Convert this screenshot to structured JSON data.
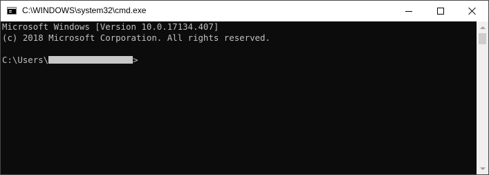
{
  "window": {
    "title": "C:\\WINDOWS\\system32\\cmd.exe",
    "icon": "cmd-icon",
    "controls": [
      "minimize-icon",
      "maximize-icon",
      "close-icon"
    ]
  },
  "console": {
    "line1": "Microsoft Windows [Version 10.0.17134.407]",
    "line2": "(c) 2018 Microsoft Corporation. All rights reserved.",
    "prompt_prefix": "C:\\Users\\",
    "prompt_suffix": ">",
    "colors": {
      "background": "#0c0c0c",
      "text": "#c0c0c0"
    }
  }
}
